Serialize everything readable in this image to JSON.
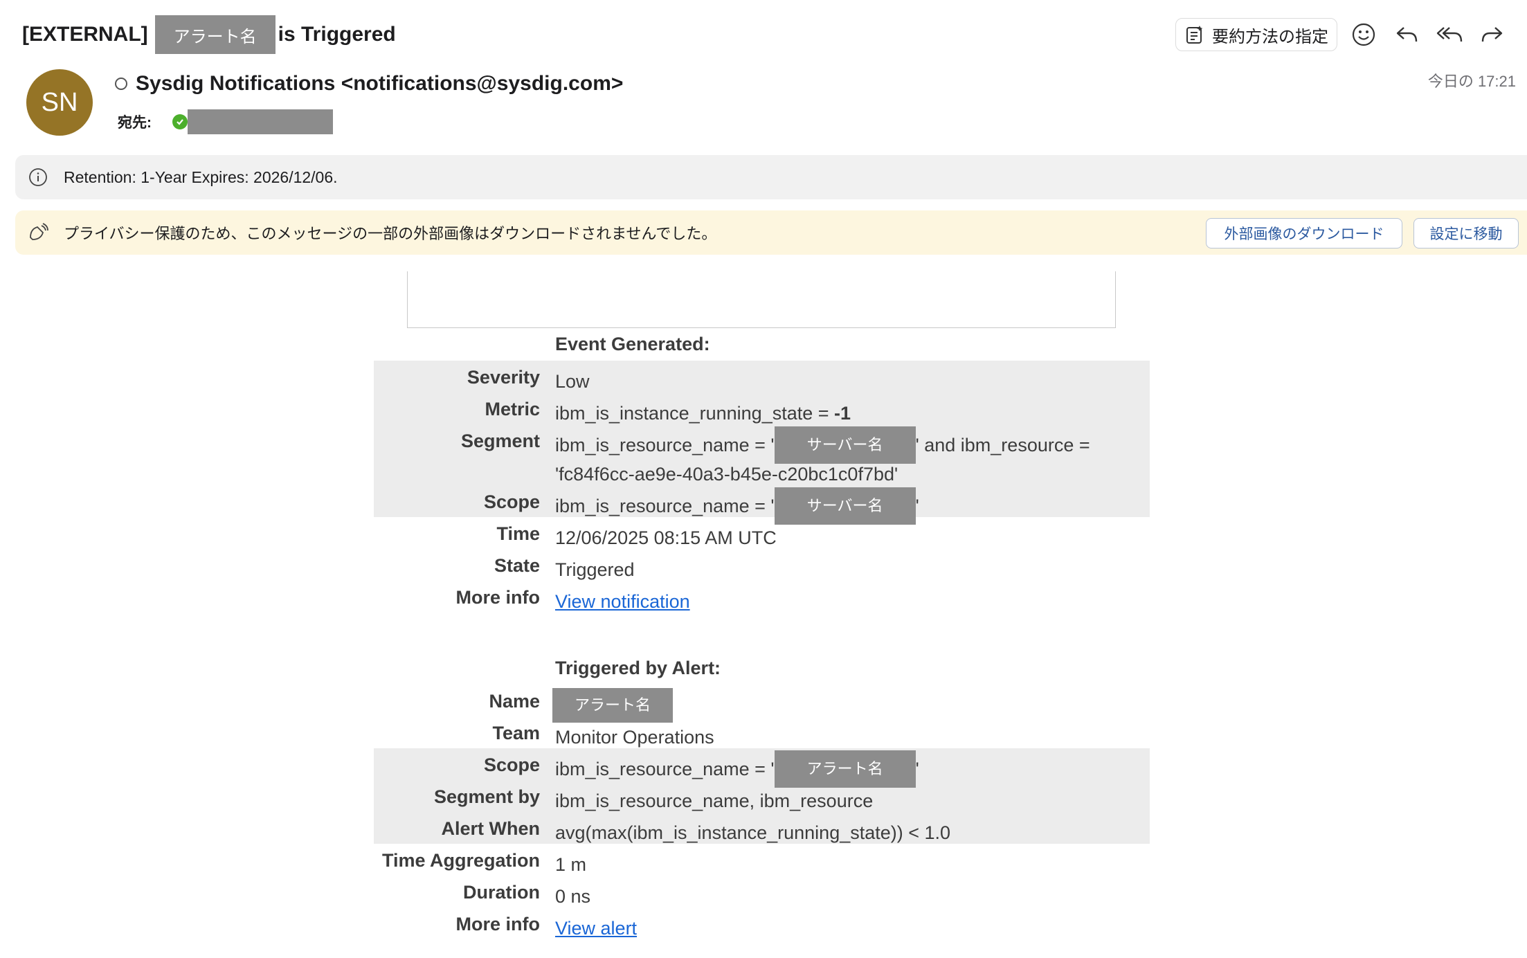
{
  "header": {
    "subject_prefix": "[EXTERNAL]",
    "subject_redacted": "アラート名",
    "subject_suffix": "is Triggered",
    "summarize_label": "要約方法の指定"
  },
  "sender": {
    "initials": "SN",
    "name": "Sysdig Notifications <notifications@sysdig.com>",
    "to_label": "宛先:",
    "timestamp": "今日の 17:21",
    "avatar_color": "#957426"
  },
  "banners": {
    "retention_text": "Retention: 1-Year Expires: 2026/12/06.",
    "privacy_text": "プライバシー保護のため、このメッセージの一部の外部画像はダウンロードされませんでした。",
    "download_button": "外部画像のダウンロード",
    "settings_button": "設定に移動"
  },
  "event": {
    "heading": "Event Generated:",
    "severity_label": "Severity",
    "severity_value": "Low",
    "metric_label": "Metric",
    "metric_value": "ibm_is_instance_running_state = ",
    "metric_threshold": "-1",
    "segment_label": "Segment",
    "segment_prefix": "ibm_is_resource_name = '",
    "segment_redacted": "サーバー名",
    "segment_suffix": "' and ibm_resource =",
    "segment_line2": "'fc84f6cc-ae9e-40a3-b45e-c20bc1c0f7bd'",
    "scope_label": "Scope",
    "scope_prefix": "ibm_is_resource_name = '",
    "scope_redacted": "サーバー名",
    "scope_suffix": "'",
    "time_label": "Time",
    "time_value": "12/06/2025 08:15 AM UTC",
    "state_label": "State",
    "state_value": "Triggered",
    "moreinfo_label": "More info",
    "moreinfo_link": "View notification"
  },
  "alert": {
    "heading": "Triggered by Alert:",
    "name_label": "Name",
    "name_redacted": "アラート名",
    "team_label": "Team",
    "team_value": "Monitor Operations",
    "scope_label": "Scope",
    "scope_prefix": "ibm_is_resource_name = '",
    "scope_redacted": "アラート名",
    "scope_suffix": "'",
    "segmentby_label": "Segment by",
    "segmentby_value": "ibm_is_resource_name, ibm_resource",
    "alertwhen_label": "Alert When",
    "alertwhen_value": "avg(max(ibm_is_instance_running_state)) < 1.0",
    "timeagg_label": "Time Aggregation",
    "timeagg_value": "1 m",
    "duration_label": "Duration",
    "duration_value": "0 ns",
    "moreinfo_label": "More info",
    "moreinfo_link": "View alert"
  }
}
